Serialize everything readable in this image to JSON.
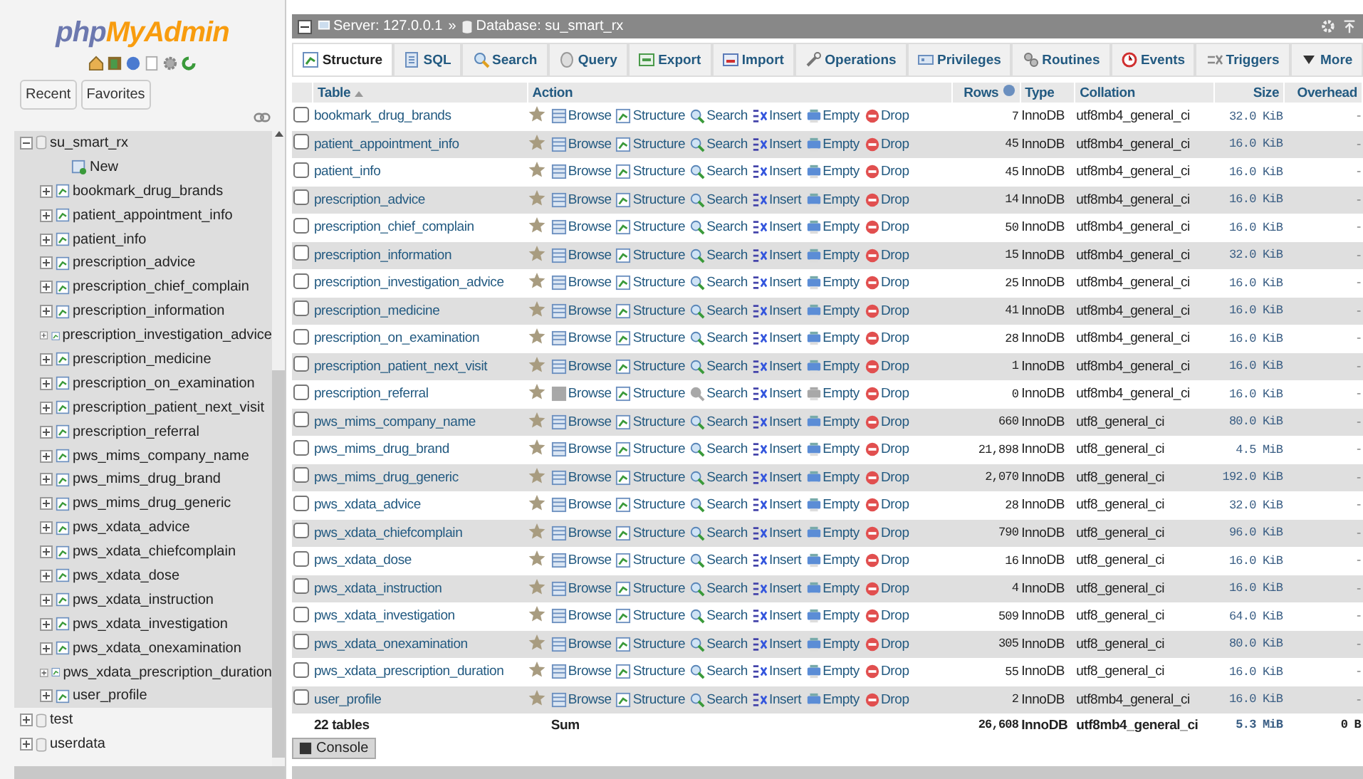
{
  "sidebar": {
    "logo": {
      "first": "php",
      "second": "MyAdmin"
    },
    "buttons": [
      "Recent",
      "Favorites"
    ],
    "tree": [
      {
        "label": "su_smart_rx",
        "kind": "database",
        "expanded": true,
        "children": [
          {
            "label": "New",
            "kind": "new"
          },
          {
            "label": "bookmark_drug_brands",
            "kind": "table",
            "expanded": false
          },
          {
            "label": "patient_appointment_info",
            "kind": "table",
            "expanded": false
          },
          {
            "label": "patient_info",
            "kind": "table",
            "expanded": false
          },
          {
            "label": "prescription_advice",
            "kind": "table",
            "expanded": false
          },
          {
            "label": "prescription_chief_complain",
            "kind": "table",
            "expanded": false
          },
          {
            "label": "prescription_information",
            "kind": "table",
            "expanded": false
          },
          {
            "label": "prescription_investigation_advice",
            "kind": "table",
            "expanded": false
          },
          {
            "label": "prescription_medicine",
            "kind": "table",
            "expanded": false
          },
          {
            "label": "prescription_on_examination",
            "kind": "table",
            "expanded": false
          },
          {
            "label": "prescription_patient_next_visit",
            "kind": "table",
            "expanded": false
          },
          {
            "label": "prescription_referral",
            "kind": "table",
            "expanded": false
          },
          {
            "label": "pws_mims_company_name",
            "kind": "table",
            "expanded": false
          },
          {
            "label": "pws_mims_drug_brand",
            "kind": "table",
            "expanded": false
          },
          {
            "label": "pws_mims_drug_generic",
            "kind": "table",
            "expanded": false
          },
          {
            "label": "pws_xdata_advice",
            "kind": "table",
            "expanded": false
          },
          {
            "label": "pws_xdata_chiefcomplain",
            "kind": "table",
            "expanded": false
          },
          {
            "label": "pws_xdata_dose",
            "kind": "table",
            "expanded": false
          },
          {
            "label": "pws_xdata_instruction",
            "kind": "table",
            "expanded": false
          },
          {
            "label": "pws_xdata_investigation",
            "kind": "table",
            "expanded": false
          },
          {
            "label": "pws_xdata_onexamination",
            "kind": "table",
            "expanded": false
          },
          {
            "label": "pws_xdata_prescription_duration",
            "kind": "table",
            "expanded": false
          },
          {
            "label": "user_profile",
            "kind": "table",
            "expanded": false
          }
        ]
      },
      {
        "label": "test",
        "kind": "database",
        "expanded": false
      },
      {
        "label": "userdata",
        "kind": "database",
        "expanded": false
      }
    ]
  },
  "breadcrumb": {
    "items": [
      {
        "label": "Server: 127.0.0.1",
        "kind": "server"
      },
      {
        "label": "Database: su_smart_rx",
        "kind": "database"
      }
    ],
    "separator": "»"
  },
  "tabs": [
    {
      "label": "Structure",
      "selected": true
    },
    {
      "label": "SQL",
      "selected": false
    },
    {
      "label": "Search",
      "selected": false
    },
    {
      "label": "Query",
      "selected": false
    },
    {
      "label": "Export",
      "selected": false
    },
    {
      "label": "Import",
      "selected": false
    },
    {
      "label": "Operations",
      "selected": false
    },
    {
      "label": "Privileges",
      "selected": false
    },
    {
      "label": "Routines",
      "selected": false
    },
    {
      "label": "Events",
      "selected": false
    },
    {
      "label": "Triggers",
      "selected": false
    },
    {
      "label": "More",
      "selected": false
    }
  ],
  "table": {
    "columns": [
      "Table",
      "Action",
      "Rows",
      "Type",
      "Collation",
      "Size",
      "Overhead"
    ],
    "rows": [
      {
        "name": "bookmark_drug_brands",
        "checked": false,
        "empty": false,
        "actions": [
          "Browse",
          "Structure",
          "Search",
          "Insert",
          "Empty",
          "Drop"
        ],
        "rows": "7",
        "type": "InnoDB",
        "collation": "utf8mb4_general_ci",
        "size": "32.0 KiB",
        "overhead": "-"
      },
      {
        "name": "patient_appointment_info",
        "checked": false,
        "empty": false,
        "actions": [
          "Browse",
          "Structure",
          "Search",
          "Insert",
          "Empty",
          "Drop"
        ],
        "rows": "45",
        "type": "InnoDB",
        "collation": "utf8mb4_general_ci",
        "size": "16.0 KiB",
        "overhead": "-"
      },
      {
        "name": "patient_info",
        "checked": false,
        "empty": false,
        "actions": [
          "Browse",
          "Structure",
          "Search",
          "Insert",
          "Empty",
          "Drop"
        ],
        "rows": "45",
        "type": "InnoDB",
        "collation": "utf8mb4_general_ci",
        "size": "16.0 KiB",
        "overhead": "-"
      },
      {
        "name": "prescription_advice",
        "checked": false,
        "empty": false,
        "actions": [
          "Browse",
          "Structure",
          "Search",
          "Insert",
          "Empty",
          "Drop"
        ],
        "rows": "14",
        "type": "InnoDB",
        "collation": "utf8mb4_general_ci",
        "size": "16.0 KiB",
        "overhead": "-"
      },
      {
        "name": "prescription_chief_complain",
        "checked": false,
        "empty": false,
        "actions": [
          "Browse",
          "Structure",
          "Search",
          "Insert",
          "Empty",
          "Drop"
        ],
        "rows": "50",
        "type": "InnoDB",
        "collation": "utf8mb4_general_ci",
        "size": "16.0 KiB",
        "overhead": "-"
      },
      {
        "name": "prescription_information",
        "checked": false,
        "empty": false,
        "actions": [
          "Browse",
          "Structure",
          "Search",
          "Insert",
          "Empty",
          "Drop"
        ],
        "rows": "15",
        "type": "InnoDB",
        "collation": "utf8mb4_general_ci",
        "size": "32.0 KiB",
        "overhead": "-"
      },
      {
        "name": "prescription_investigation_advice",
        "checked": false,
        "empty": false,
        "actions": [
          "Browse",
          "Structure",
          "Search",
          "Insert",
          "Empty",
          "Drop"
        ],
        "rows": "25",
        "type": "InnoDB",
        "collation": "utf8mb4_general_ci",
        "size": "16.0 KiB",
        "overhead": "-"
      },
      {
        "name": "prescription_medicine",
        "checked": false,
        "empty": false,
        "actions": [
          "Browse",
          "Structure",
          "Search",
          "Insert",
          "Empty",
          "Drop"
        ],
        "rows": "41",
        "type": "InnoDB",
        "collation": "utf8mb4_general_ci",
        "size": "16.0 KiB",
        "overhead": "-"
      },
      {
        "name": "prescription_on_examination",
        "checked": false,
        "empty": false,
        "actions": [
          "Browse",
          "Structure",
          "Search",
          "Insert",
          "Empty",
          "Drop"
        ],
        "rows": "28",
        "type": "InnoDB",
        "collation": "utf8mb4_general_ci",
        "size": "16.0 KiB",
        "overhead": "-"
      },
      {
        "name": "prescription_patient_next_visit",
        "checked": false,
        "empty": false,
        "actions": [
          "Browse",
          "Structure",
          "Search",
          "Insert",
          "Empty",
          "Drop"
        ],
        "rows": "1",
        "type": "InnoDB",
        "collation": "utf8mb4_general_ci",
        "size": "16.0 KiB",
        "overhead": "-"
      },
      {
        "name": "prescription_referral",
        "checked": false,
        "empty": true,
        "actions": [
          "Browse",
          "Structure",
          "Search",
          "Insert",
          "Empty",
          "Drop"
        ],
        "rows": "0",
        "type": "InnoDB",
        "collation": "utf8mb4_general_ci",
        "size": "16.0 KiB",
        "overhead": "-"
      },
      {
        "name": "pws_mims_company_name",
        "checked": false,
        "empty": false,
        "actions": [
          "Browse",
          "Structure",
          "Search",
          "Insert",
          "Empty",
          "Drop"
        ],
        "rows": "660",
        "type": "InnoDB",
        "collation": "utf8_general_ci",
        "size": "80.0 KiB",
        "overhead": "-"
      },
      {
        "name": "pws_mims_drug_brand",
        "checked": false,
        "empty": false,
        "actions": [
          "Browse",
          "Structure",
          "Search",
          "Insert",
          "Empty",
          "Drop"
        ],
        "rows": "21,898",
        "type": "InnoDB",
        "collation": "utf8_general_ci",
        "size": "4.5 MiB",
        "overhead": "-"
      },
      {
        "name": "pws_mims_drug_generic",
        "checked": false,
        "empty": false,
        "actions": [
          "Browse",
          "Structure",
          "Search",
          "Insert",
          "Empty",
          "Drop"
        ],
        "rows": "2,070",
        "type": "InnoDB",
        "collation": "utf8_general_ci",
        "size": "192.0 KiB",
        "overhead": "-"
      },
      {
        "name": "pws_xdata_advice",
        "checked": false,
        "empty": false,
        "actions": [
          "Browse",
          "Structure",
          "Search",
          "Insert",
          "Empty",
          "Drop"
        ],
        "rows": "28",
        "type": "InnoDB",
        "collation": "utf8_general_ci",
        "size": "32.0 KiB",
        "overhead": "-"
      },
      {
        "name": "pws_xdata_chiefcomplain",
        "checked": false,
        "empty": false,
        "actions": [
          "Browse",
          "Structure",
          "Search",
          "Insert",
          "Empty",
          "Drop"
        ],
        "rows": "790",
        "type": "InnoDB",
        "collation": "utf8_general_ci",
        "size": "96.0 KiB",
        "overhead": "-"
      },
      {
        "name": "pws_xdata_dose",
        "checked": false,
        "empty": false,
        "actions": [
          "Browse",
          "Structure",
          "Search",
          "Insert",
          "Empty",
          "Drop"
        ],
        "rows": "16",
        "type": "InnoDB",
        "collation": "utf8_general_ci",
        "size": "16.0 KiB",
        "overhead": "-"
      },
      {
        "name": "pws_xdata_instruction",
        "checked": false,
        "empty": false,
        "actions": [
          "Browse",
          "Structure",
          "Search",
          "Insert",
          "Empty",
          "Drop"
        ],
        "rows": "4",
        "type": "InnoDB",
        "collation": "utf8_general_ci",
        "size": "16.0 KiB",
        "overhead": "-"
      },
      {
        "name": "pws_xdata_investigation",
        "checked": false,
        "empty": false,
        "actions": [
          "Browse",
          "Structure",
          "Search",
          "Insert",
          "Empty",
          "Drop"
        ],
        "rows": "509",
        "type": "InnoDB",
        "collation": "utf8_general_ci",
        "size": "64.0 KiB",
        "overhead": "-"
      },
      {
        "name": "pws_xdata_onexamination",
        "checked": false,
        "empty": false,
        "actions": [
          "Browse",
          "Structure",
          "Search",
          "Insert",
          "Empty",
          "Drop"
        ],
        "rows": "305",
        "type": "InnoDB",
        "collation": "utf8_general_ci",
        "size": "80.0 KiB",
        "overhead": "-"
      },
      {
        "name": "pws_xdata_prescription_duration",
        "checked": false,
        "empty": false,
        "actions": [
          "Browse",
          "Structure",
          "Search",
          "Insert",
          "Empty",
          "Drop"
        ],
        "rows": "55",
        "type": "InnoDB",
        "collation": "utf8_general_ci",
        "size": "16.0 KiB",
        "overhead": "-"
      },
      {
        "name": "user_profile",
        "checked": false,
        "empty": false,
        "actions": [
          "Browse",
          "Structure",
          "Search",
          "Insert",
          "Empty",
          "Drop"
        ],
        "rows": "2",
        "type": "InnoDB",
        "collation": "utf8mb4_general_ci",
        "size": "16.0 KiB",
        "overhead": "-"
      }
    ],
    "footer": {
      "label": "22 tables",
      "sum": "Sum",
      "rows": "26,608",
      "type": "InnoDB",
      "collation": "utf8mb4_general_ci",
      "size": "5.3 MiB",
      "overhead": "0 B"
    }
  },
  "console": {
    "label": "Console"
  }
}
